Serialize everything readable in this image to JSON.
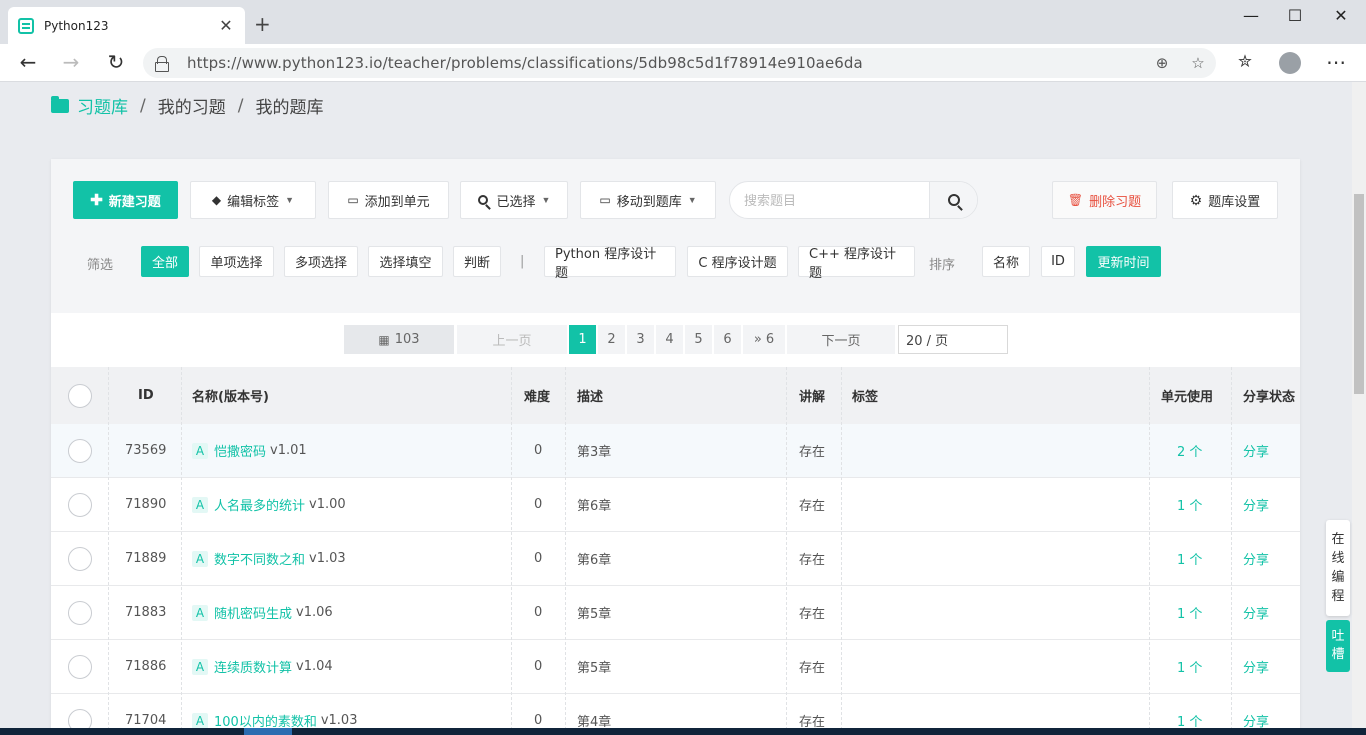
{
  "browser": {
    "tab_title": "Python123",
    "tab_close": "✕",
    "new_tab": "+",
    "url": "https://www.python123.io/teacher/problems/classifications/5db98c5d1f78914e910ae6da",
    "window_minimize": "—",
    "window_maximize": "☐",
    "window_close": "✕",
    "back": "←",
    "forward": "→",
    "reload": "↻",
    "zoom_icon": "⊕",
    "star_icon": "☆",
    "favorites_icon": "✮",
    "more_icon": "⋯"
  },
  "breadcrumb": {
    "items": [
      "习题库",
      "我的习题",
      "我的题库"
    ],
    "separator": "/"
  },
  "toolbar": {
    "new_problem": "新建习题",
    "edit_tags": "编辑标签",
    "add_to_unit": "添加到单元",
    "selected": "已选择",
    "move_to_bank": "移动到题库",
    "search_placeholder": "搜索题目",
    "delete_problem": "删除习题",
    "bank_settings": "题库设置"
  },
  "filters": {
    "label": "筛选",
    "types": [
      "全部",
      "单项选择",
      "多项选择",
      "选择填空",
      "判断"
    ],
    "divider": "|",
    "courses": [
      "Python 程序设计题",
      "C 程序设计题",
      "C++ 程序设计题"
    ],
    "sort_label": "排序",
    "sorts": [
      "名称",
      "ID",
      "更新时间"
    ],
    "active_type": "全部",
    "active_sort": "更新时间"
  },
  "pagination": {
    "total": "103",
    "prev": "上一页",
    "pages": [
      "1",
      "2",
      "3",
      "4",
      "5",
      "6"
    ],
    "last": "» 6",
    "next": "下一页",
    "per_page": "20 / 页",
    "current": "1"
  },
  "table": {
    "headers": {
      "id": "ID",
      "name": "名称(版本号)",
      "difficulty": "难度",
      "description": "描述",
      "explanation": "讲解",
      "tags": "标签",
      "unit_usage": "单元使用",
      "share_status": "分享状态"
    },
    "rows": [
      {
        "id": "73569",
        "type": "A",
        "name": "恺撒密码",
        "version": "v1.01",
        "difficulty": "0",
        "description": "第3章",
        "explanation": "存在",
        "tags": "",
        "units": "2 个",
        "share": "分享"
      },
      {
        "id": "71890",
        "type": "A",
        "name": "人名最多的统计",
        "version": "v1.00",
        "difficulty": "0",
        "description": "第6章",
        "explanation": "存在",
        "tags": "",
        "units": "1 个",
        "share": "分享"
      },
      {
        "id": "71889",
        "type": "A",
        "name": "数字不同数之和",
        "version": "v1.03",
        "difficulty": "0",
        "description": "第6章",
        "explanation": "存在",
        "tags": "",
        "units": "1 个",
        "share": "分享"
      },
      {
        "id": "71883",
        "type": "A",
        "name": "随机密码生成",
        "version": "v1.06",
        "difficulty": "0",
        "description": "第5章",
        "explanation": "存在",
        "tags": "",
        "units": "1 个",
        "share": "分享"
      },
      {
        "id": "71886",
        "type": "A",
        "name": "连续质数计算",
        "version": "v1.04",
        "difficulty": "0",
        "description": "第5章",
        "explanation": "存在",
        "tags": "",
        "units": "1 个",
        "share": "分享"
      },
      {
        "id": "71704",
        "type": "A",
        "name": "100以内的素数和",
        "version": "v1.03",
        "difficulty": "0",
        "description": "第4章",
        "explanation": "存在",
        "tags": "",
        "units": "1 个",
        "share": "分享"
      }
    ]
  },
  "side": {
    "online_coding": [
      "在",
      "线",
      "编",
      "程"
    ],
    "feedback": [
      "吐",
      "槽"
    ]
  },
  "colors": {
    "accent": "#12c2a7",
    "danger": "#e8503f"
  }
}
